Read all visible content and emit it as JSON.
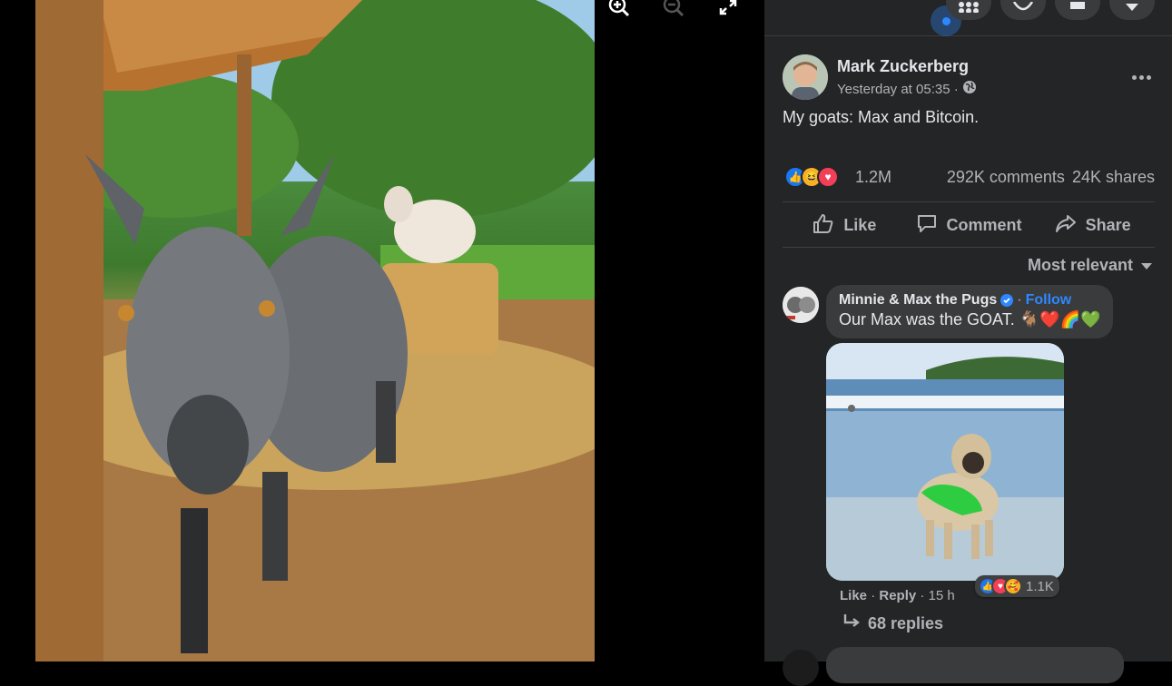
{
  "viewer": {
    "tools": [
      "zoom-in",
      "zoom-out",
      "fullscreen"
    ]
  },
  "topbar": {
    "icons": [
      "menu-grid",
      "messenger",
      "notifications",
      "account-menu"
    ]
  },
  "post": {
    "author": "Mark Zuckerberg",
    "timestamp": "Yesterday at 05:35 ·",
    "privacy_icon": "globe-icon",
    "caption": "My goats: Max and Bitcoin.",
    "reactions": [
      "like",
      "haha",
      "love"
    ],
    "reaction_count": "1.2M",
    "comments": "292K comments",
    "shares": "24K shares",
    "actions": {
      "like": "Like",
      "comment": "Comment",
      "share": "Share"
    }
  },
  "comments_section": {
    "sort_label": "Most relevant",
    "comments": [
      {
        "name": "Minnie & Max the Pugs",
        "verified": true,
        "follow_label": "Follow",
        "separator": "·",
        "text": "Our Max was the GOAT. 🐐❤️🌈💚",
        "reactions": [
          "like",
          "love",
          "care"
        ],
        "reaction_count": "1.1K",
        "like_label": "Like",
        "reply_label": "Reply",
        "time": "15 h",
        "replies_label": "68 replies"
      }
    ]
  },
  "colors": {
    "panel_bg": "#242526",
    "bubble_bg": "#3a3b3c",
    "accent": "#2d88ff",
    "text_primary": "#e4e6eb",
    "text_secondary": "#b0b3b8"
  }
}
